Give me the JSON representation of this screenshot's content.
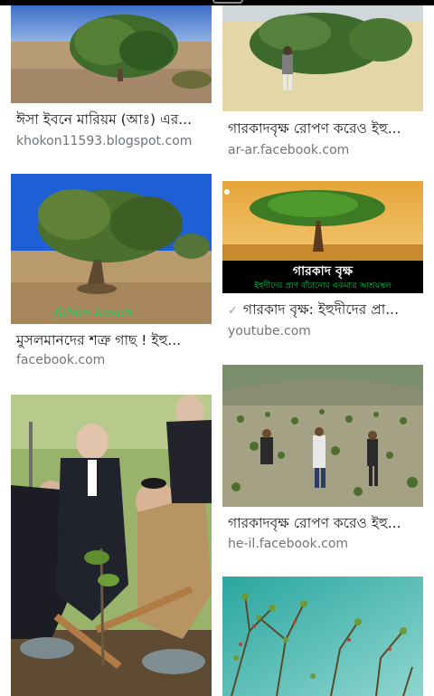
{
  "results": [
    {
      "title": "ঈসা ইবনে মারিয়ম (আঃ) এর...",
      "source": "khokon11593.blogspot.com",
      "image_alt": "gharkad-tree-desert"
    },
    {
      "title": "গারকাদবৃক্ষ রোপণ করেও ইহু...",
      "source": "ar-ar.facebook.com",
      "image_alt": "man-beside-gharkad-bush"
    },
    {
      "title": "মুসলমানদের শত্রু গাছ ! ইহু...",
      "source": "facebook.com",
      "image_alt": "olive-like-tree-blue-sky",
      "watermark": "fahim hasan"
    },
    {
      "title": "গারকাদ বৃক্ষ: ইহুদীদের প্রা...",
      "source": "youtube.com",
      "image_alt": "gharkad-tree-poster",
      "poster_title": "গারকাদ বৃক্ষ",
      "poster_caption": "ইহুদীদের প্রাণ বাঁচানোর একমাত্র আশ্রয়স্থল",
      "icon": "checkmark-icon"
    },
    {
      "title": "",
      "source": "",
      "image_alt": "men-planting-trees"
    },
    {
      "title": "গারকাদবৃক্ষ রোপণ করেও ইহু...",
      "source": "he-il.facebook.com",
      "image_alt": "workers-planting-hillside"
    },
    {
      "title": "",
      "source": "",
      "image_alt": "thorny-branches-teal-sky"
    }
  ],
  "colors": {
    "title": "#202124",
    "source": "#70757a",
    "poster_green": "#00a651",
    "poster_black": "#000000"
  }
}
